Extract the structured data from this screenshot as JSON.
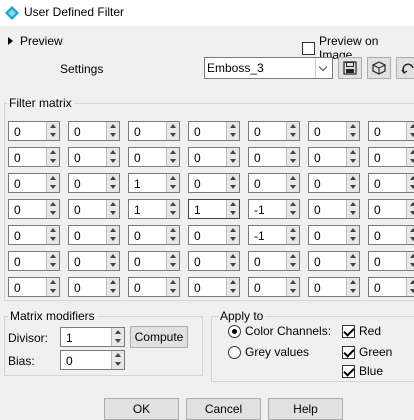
{
  "window": {
    "title": "User Defined Filter"
  },
  "preview": {
    "label": "Preview",
    "preview_on_image_label": "Preview on Image",
    "preview_on_image_checked": false
  },
  "settings": {
    "label": "Settings",
    "value": "Emboss_3"
  },
  "matrix": {
    "title": "Filter matrix",
    "rows": [
      [
        "0",
        "0",
        "0",
        "0",
        "0",
        "0",
        "0"
      ],
      [
        "0",
        "0",
        "0",
        "0",
        "0",
        "0",
        "0"
      ],
      [
        "0",
        "0",
        "1",
        "0",
        "0",
        "0",
        "0"
      ],
      [
        "0",
        "0",
        "1",
        "1",
        "-1",
        "0",
        "0"
      ],
      [
        "0",
        "0",
        "0",
        "0",
        "-1",
        "0",
        "0"
      ],
      [
        "0",
        "0",
        "0",
        "0",
        "0",
        "0",
        "0"
      ],
      [
        "0",
        "0",
        "0",
        "0",
        "0",
        "0",
        "0"
      ]
    ]
  },
  "modifiers": {
    "title": "Matrix modifiers",
    "divisor_label": "Divisor:",
    "divisor_value": "1",
    "compute_label": "Compute",
    "bias_label": "Bias:",
    "bias_value": "0"
  },
  "apply": {
    "title": "Apply to",
    "color_channels_label": "Color Channels:",
    "grey_values_label": "Grey values",
    "selected": "color_channels",
    "red_label": "Red",
    "green_label": "Green",
    "blue_label": "Blue"
  },
  "buttons": {
    "ok": "OK",
    "cancel": "Cancel",
    "help": "Help"
  }
}
